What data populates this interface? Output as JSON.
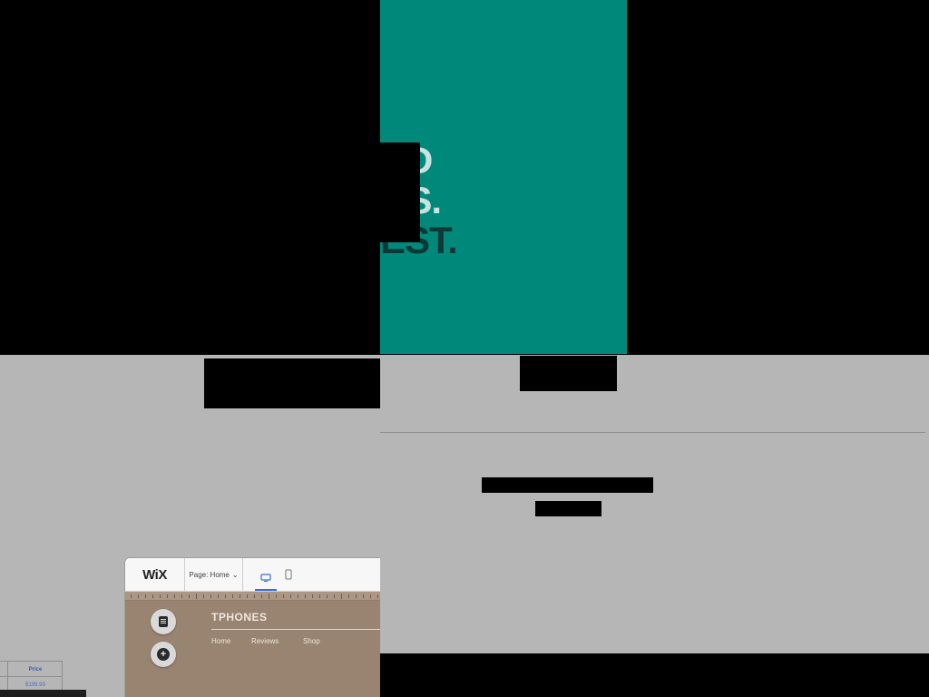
{
  "hero": {
    "lines": [
      "D",
      "US.",
      "EST."
    ]
  },
  "wix_editor": {
    "logo": "WiX",
    "page_selector": "Page: Home",
    "page_chevron": "⌄",
    "site": {
      "title": "TPHONES",
      "nav": [
        "Home",
        "Reviews",
        "Shop"
      ]
    },
    "side_buttons": [
      "pages-icon",
      "add-icon"
    ]
  },
  "table_fragment": {
    "header": "Price",
    "value": "$199.99"
  },
  "colors": {
    "teal": "#00897b",
    "grey_bg": "#b6b6b6",
    "wix_canvas": "#998371",
    "accent_blue": "#3b6fc9"
  }
}
